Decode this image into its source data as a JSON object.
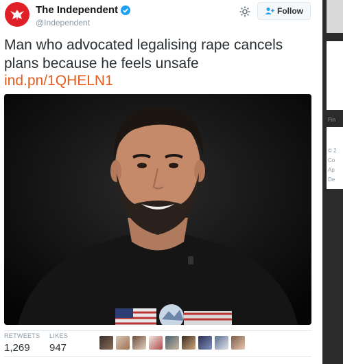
{
  "tweet": {
    "display_name": "The Independent",
    "handle": "@Independent",
    "text": "Man who advocated legalising rape cancels plans because he feels unsafe",
    "link": "ind.pn/1QHELN1",
    "follow_label": "Follow",
    "stats": {
      "retweets_label": "RETWEETS",
      "retweets_value": "1,269",
      "likes_label": "LIKES",
      "likes_value": "947"
    }
  },
  "side_panel": {
    "snippets": [
      "Fin",
      "© 2",
      "Co",
      "Ap",
      "De"
    ]
  },
  "icons": {
    "avatar": "eagle-logo-icon",
    "verified": "verified-badge-icon",
    "settings": "gear-icon",
    "follow": "add-user-icon"
  },
  "colors": {
    "brand_red": "#e01f26",
    "link_orange": "#e65c1e",
    "verified_blue": "#1da1f2"
  }
}
